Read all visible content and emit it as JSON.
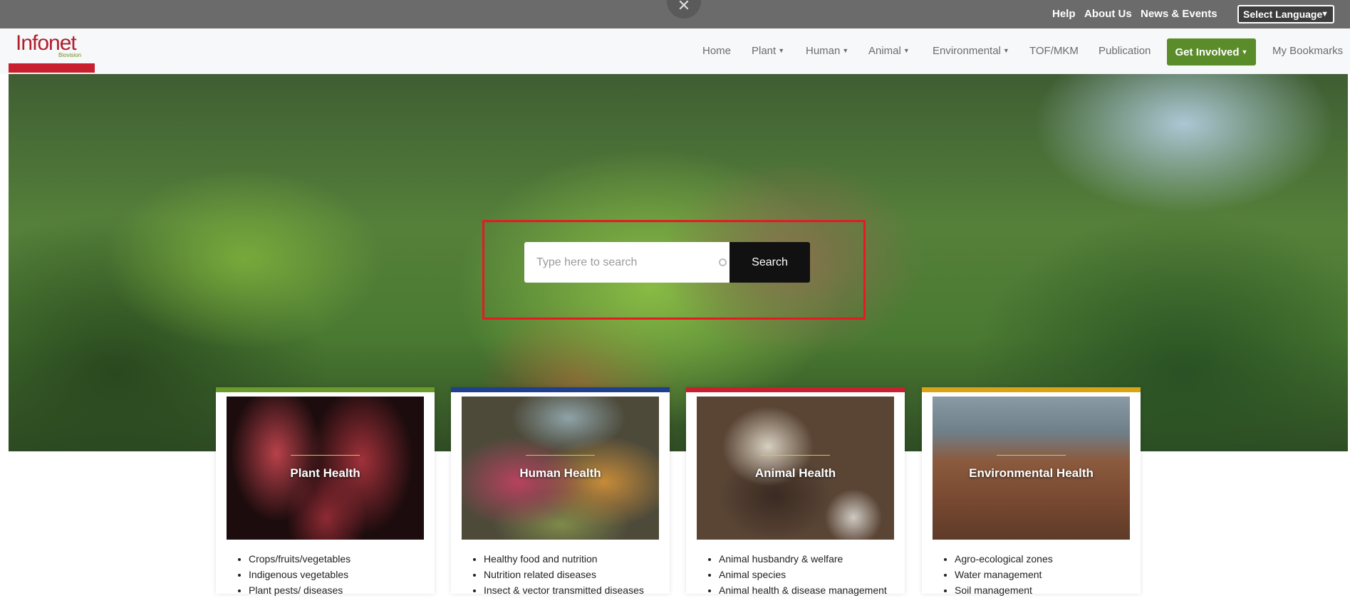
{
  "topbar": {
    "links": [
      "Help",
      "About Us",
      "News & Events"
    ],
    "language_label": "Select Language"
  },
  "logo": {
    "title": "Infonet",
    "subtitle": "Biovision"
  },
  "nav": {
    "items": [
      {
        "label": "Home",
        "dropdown": false
      },
      {
        "label": "Plant",
        "dropdown": true
      },
      {
        "label": "Human",
        "dropdown": true
      },
      {
        "label": "Animal",
        "dropdown": true
      },
      {
        "label": "Environmental",
        "dropdown": true
      },
      {
        "label": "TOF/MKM",
        "dropdown": false
      },
      {
        "label": "Publication",
        "dropdown": false
      }
    ],
    "get_involved": "Get Involved",
    "bookmarks": "My Bookmarks"
  },
  "search": {
    "placeholder": "Type here to search",
    "button": "Search"
  },
  "cards": [
    {
      "title": "Plant Health",
      "color": "#6b9b2a",
      "items": [
        "Crops/fruits/vegetables",
        "Indigenous vegetables",
        "Plant pests/ diseases"
      ]
    },
    {
      "title": "Human Health",
      "color": "#1f3f8f",
      "items": [
        "Healthy food and nutrition",
        "Nutrition related diseases",
        "Insect & vector transmitted diseases"
      ]
    },
    {
      "title": "Animal Health",
      "color": "#c8202f",
      "items": [
        "Animal husbandry & welfare",
        "Animal species",
        "Animal health & disease management"
      ]
    },
    {
      "title": "Environmental Health",
      "color": "#d9a516",
      "items": [
        "Agro-ecological zones",
        "Water management",
        "Soil management"
      ]
    }
  ],
  "colors": {
    "accent_green": "#5b8c2a",
    "brand_red": "#c8202f",
    "highlight_red": "#e31b23"
  }
}
